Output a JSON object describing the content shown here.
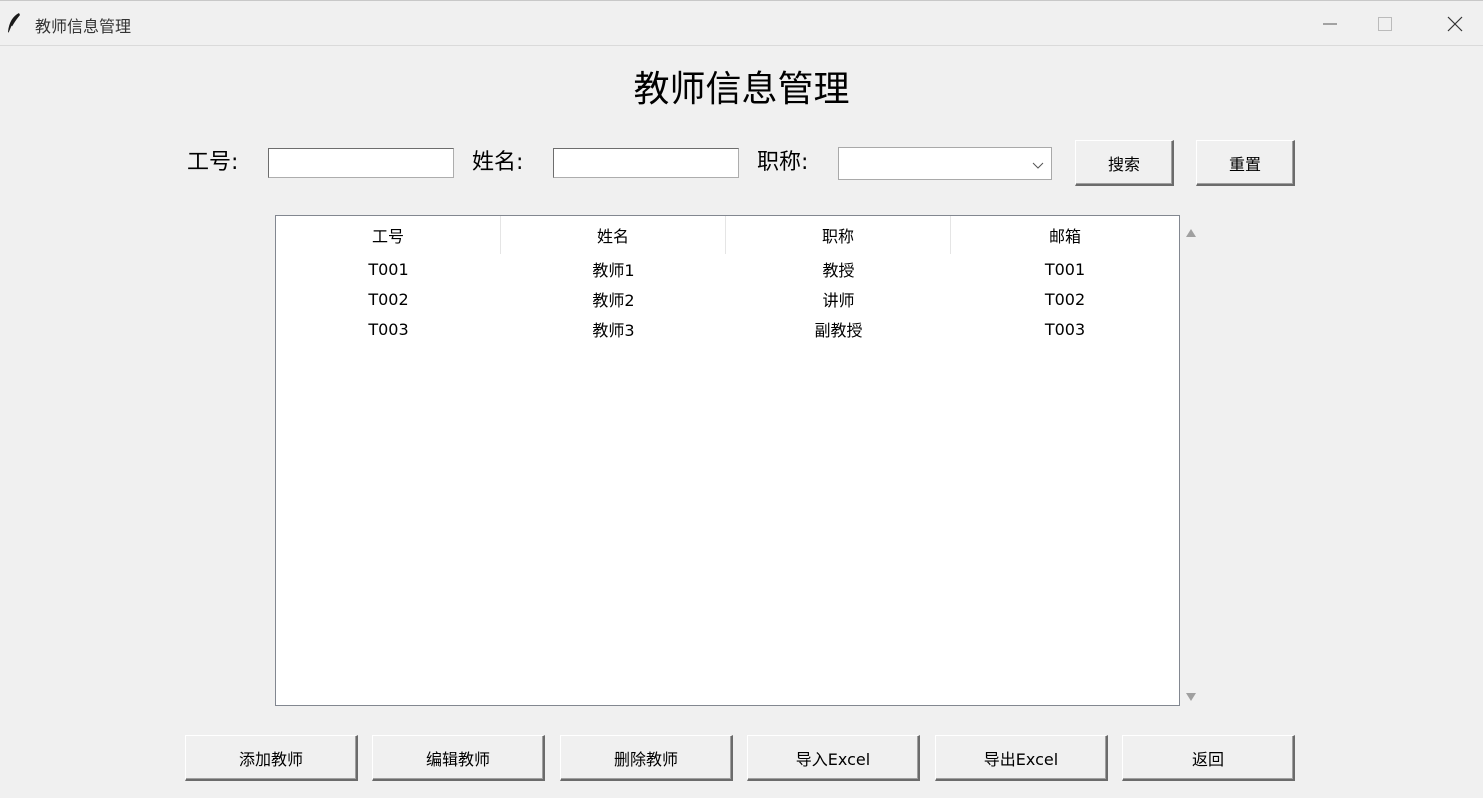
{
  "window": {
    "title": "教师信息管理",
    "icon": "feather-icon",
    "controls": [
      "minimize-icon",
      "maximize-icon",
      "close-icon"
    ]
  },
  "heading": "教师信息管理",
  "search": {
    "id_label": "工号:",
    "id_value": "",
    "name_label": "姓名:",
    "name_value": "",
    "title_label": "职称:",
    "title_selected": "",
    "search_button": "搜索",
    "reset_button": "重置"
  },
  "table": {
    "columns": [
      "工号",
      "姓名",
      "职称",
      "邮箱"
    ],
    "rows": [
      [
        "T001",
        "教师1",
        "教授",
        "T001"
      ],
      [
        "T002",
        "教师2",
        "讲师",
        "T002"
      ],
      [
        "T003",
        "教师3",
        "副教授",
        "T003"
      ]
    ]
  },
  "actions": {
    "add": "添加教师",
    "edit": "编辑教师",
    "delete": "删除教师",
    "import": "导入Excel",
    "export": "导出Excel",
    "back": "返回"
  },
  "colors": {
    "background": "#f0f0f0",
    "table_background": "#ffffff",
    "border": "#828790"
  }
}
